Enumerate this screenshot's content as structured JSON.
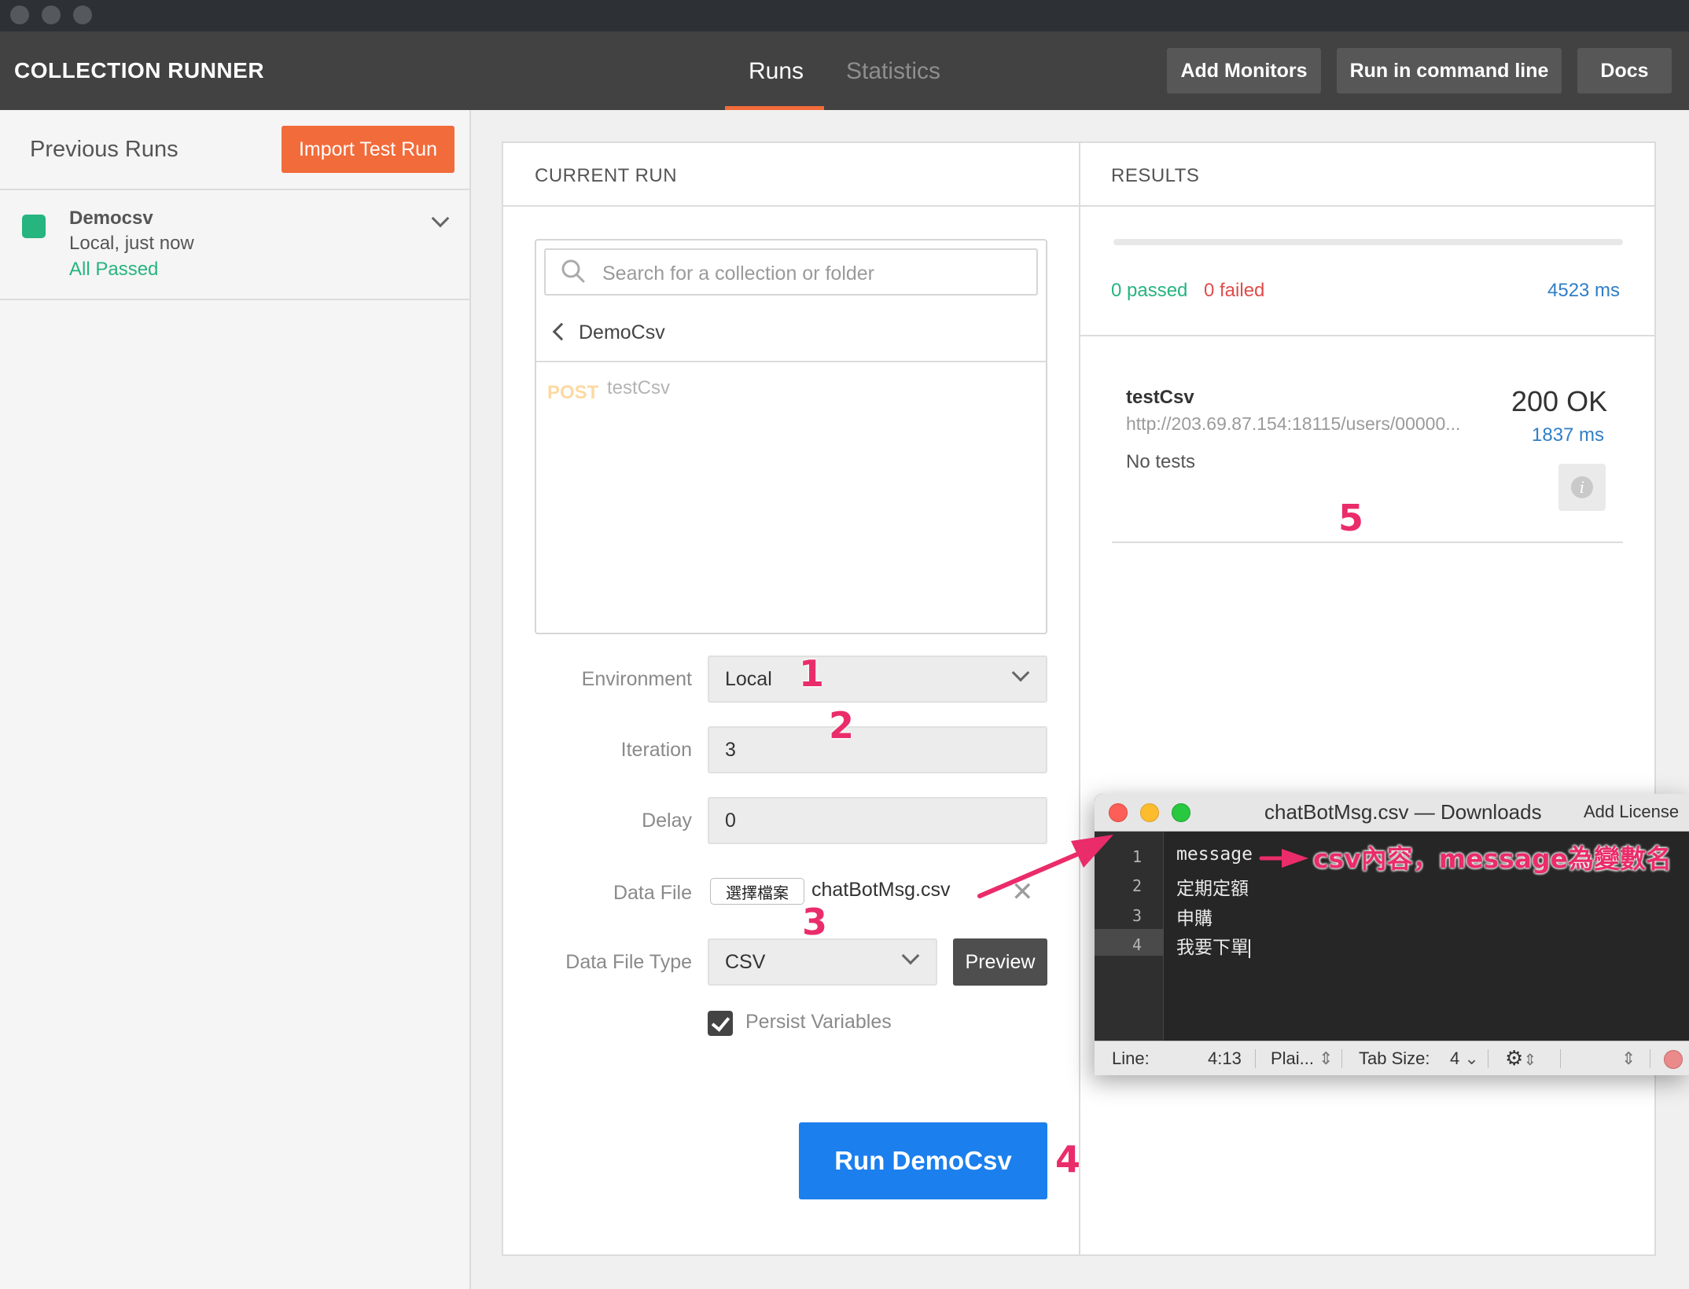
{
  "app": {
    "title": "COLLECTION RUNNER",
    "tabs": [
      {
        "label": "Runs",
        "active": true
      },
      {
        "label": "Statistics",
        "active": false
      }
    ],
    "header_buttons": [
      "Add Monitors",
      "Run in command line",
      "Docs"
    ]
  },
  "sidebar": {
    "title": "Previous Runs",
    "import_label": "Import Test Run",
    "runs": [
      {
        "name": "Democsv",
        "meta": "Local, just now",
        "status": "All Passed",
        "color": "#26b47f"
      }
    ]
  },
  "current_run": {
    "section_title": "CURRENT RUN",
    "search_placeholder": "Search for a collection or folder",
    "breadcrumb": "DemoCsv",
    "requests": [
      {
        "method": "POST",
        "name": "testCsv"
      }
    ],
    "form": {
      "environment_label": "Environment",
      "environment_value": "Local",
      "iteration_label": "Iteration",
      "iteration_value": "3",
      "delay_label": "Delay",
      "delay_value": "0",
      "data_file_label": "Data File",
      "file_button": "選擇檔案",
      "file_name": "chatBotMsg.csv",
      "data_file_type_label": "Data File Type",
      "data_file_type_value": "CSV",
      "preview_label": "Preview",
      "persist_label": "Persist Variables",
      "persist_checked": true
    },
    "run_button": "Run DemoCsv"
  },
  "results": {
    "section_title": "RESULTS",
    "passed": "0 passed",
    "failed": "0 failed",
    "total_time": "4523 ms",
    "items": [
      {
        "name": "testCsv",
        "url": "http://203.69.87.154:18115/users/00000...",
        "status": "200 OK",
        "time": "1837 ms",
        "tests": "No tests"
      }
    ]
  },
  "annotations": [
    "1",
    "2",
    "3",
    "4",
    "5"
  ],
  "editor": {
    "title": "chatBotMsg.csv — Downloads",
    "license": "Add License",
    "lines": [
      {
        "n": "1",
        "text": "message"
      },
      {
        "n": "2",
        "text": "定期定額"
      },
      {
        "n": "3",
        "text": "申購"
      },
      {
        "n": "4",
        "text": "我要下單"
      }
    ],
    "callout": "csv內容，message為變數名",
    "status": {
      "line_label": "Line:",
      "position": "4:13",
      "syntax": "Plai...",
      "tab_label": "Tab Size:",
      "tab_value": "4"
    }
  },
  "colors": {
    "accent": "#f26b3a",
    "primary": "#1b7fee",
    "pass": "#26b47f",
    "fail": "#e14b4b",
    "annotation": "#ea2c6a"
  }
}
